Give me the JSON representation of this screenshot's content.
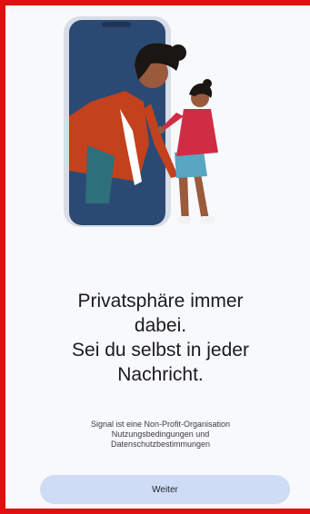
{
  "onboarding": {
    "headline_lines": [
      "Privatsphäre immer",
      "dabei.",
      "Sei du selbst in jeder",
      "Nachricht."
    ],
    "terms_lines": [
      "Signal ist eine Non-Profit-Organisation",
      "Nutzungsbedingungen und",
      "Datenschutzbestimmungen"
    ],
    "continue_label": "Weiter"
  },
  "colors": {
    "frame": "#e20f10",
    "background": "#f8f9fc",
    "button": "#cfdcf5",
    "phone": "#2b4a73"
  }
}
